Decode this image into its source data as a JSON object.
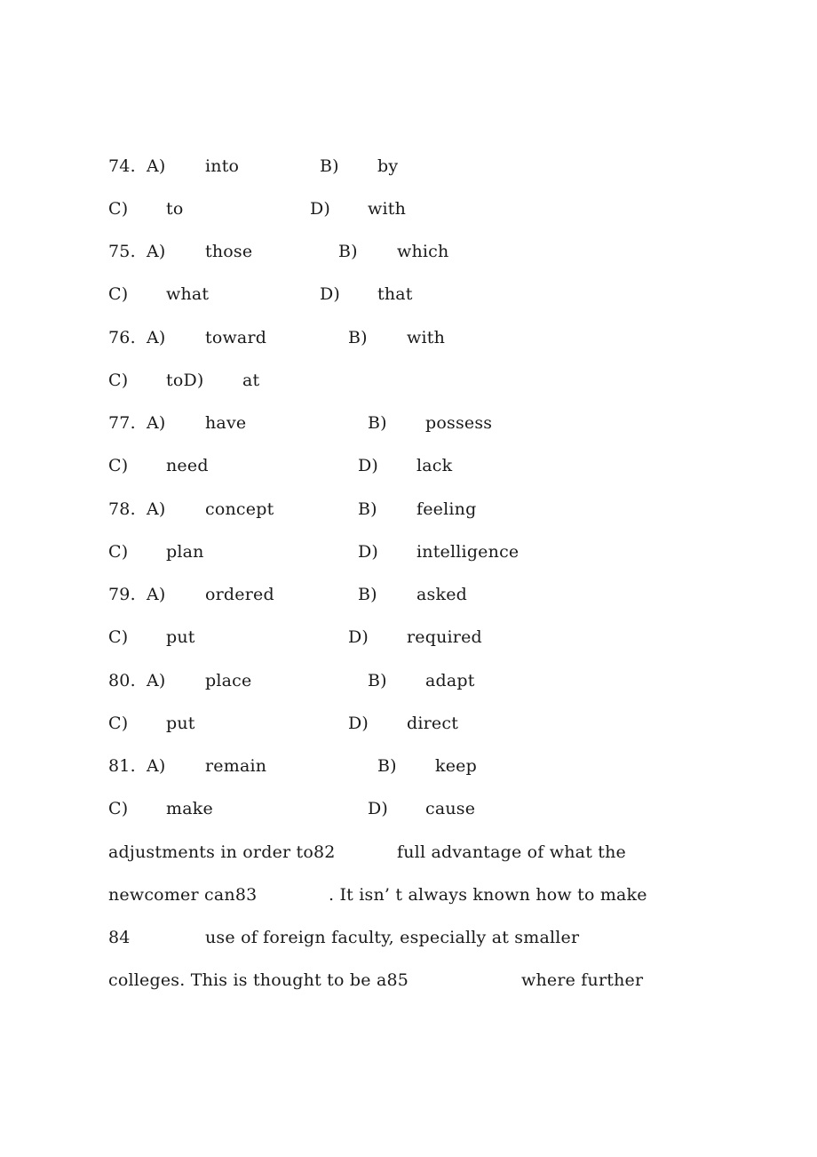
{
  "questions": [
    {
      "number": "74.",
      "A": "into",
      "B": "by",
      "C": "to",
      "D": "with"
    },
    {
      "number": "75.",
      "A": "those",
      "B": "which",
      "C": "what",
      "D": "that"
    },
    {
      "number": "76.",
      "A": "toward",
      "B": "with",
      "C": "toD)",
      "D": "at"
    },
    {
      "number": "77.",
      "A": "have",
      "B": "possess",
      "C": "need",
      "D": "lack"
    },
    {
      "number": "78.",
      "A": "concept",
      "B": "feeling",
      "C": "plan",
      "D": "intelligence"
    },
    {
      "number": "79.",
      "A": "ordered",
      "B": "asked",
      "C": "put",
      "D": "required"
    },
    {
      "number": "80.",
      "A": "place",
      "B": "adapt",
      "C": "put",
      "D": "direct"
    },
    {
      "number": "81.",
      "A": "remain",
      "B": "keep",
      "C": "make",
      "D": "cause"
    }
  ],
  "labels": {
    "A": "A)",
    "B": "B)",
    "C": "C)",
    "D": "D)"
  },
  "passage": [
    {
      "parts": [
        "adjustments in order to82",
        "full advantage of what the"
      ]
    },
    {
      "parts": [
        "newcomer can83",
        ". It isn’ t always known how to make"
      ]
    },
    {
      "parts": [
        "84",
        "use of foreign faculty, especially at smaller"
      ]
    },
    {
      "parts": [
        "colleges. This is thought to be a85",
        "where further"
      ]
    }
  ]
}
